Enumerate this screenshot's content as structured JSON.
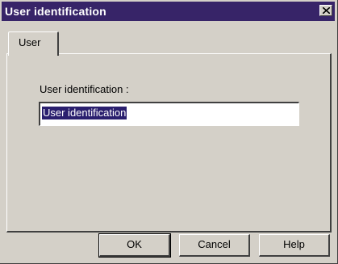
{
  "window": {
    "title": "User identification"
  },
  "tabs": [
    {
      "label": "User",
      "active": true
    }
  ],
  "form": {
    "field_label": "User identification :",
    "field_value": "User identification"
  },
  "buttons": {
    "ok": "OK",
    "cancel": "Cancel",
    "help": "Help"
  },
  "colors": {
    "titlebar": "#372468",
    "selection": "#2a1f6e",
    "face": "#d4d0c8"
  },
  "icons": {
    "close": "close-icon"
  }
}
